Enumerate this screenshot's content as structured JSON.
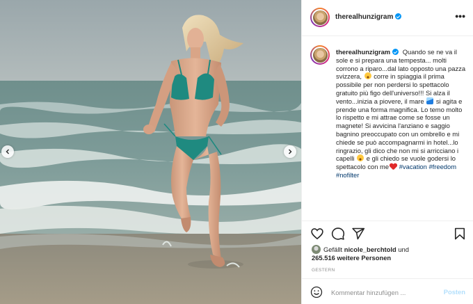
{
  "post": {
    "username": "therealhunzigram",
    "verified": true
  },
  "header": {
    "more_icon": "more-horizontal-icon"
  },
  "caption": {
    "username": "therealhunzigram",
    "part1": "Quando se ne va il sole e si prepara una tempesta... molti corrono a riparo...dal lato opposto una pazza svizzera,",
    "part2": "corre in spiaggia il prima possibile per non perdersi lo spettacolo gratuito più figo dell'universo!!! Si alza il vento...inizia a piovere, il mare",
    "part3": "si agita e prende una forma magnifica. Lo temo molto lo rispetto e mi attrae come se fosse un magnete! Si avvicina l'anziano e saggio bagnino preoccupato con un ombrello e mi chiede se può accompagnarmi in hotel...lo ringrazio, gli dico che non mi si arricciano i capelli",
    "part4": "e gli chiedo se vuole godersi lo spettacolo con me",
    "hashtags": "#vacation #freedom #nofilter"
  },
  "likes": {
    "prefix": "Gefällt",
    "liker": "nicole_berchtold",
    "connector": "und",
    "count": "265.516 weitere Personen"
  },
  "date": "GESTERN",
  "composer": {
    "placeholder": "Kommentar hinzufügen ...",
    "post_label": "Posten"
  },
  "colors": {
    "verified": "#0095f6",
    "link": "#00376b",
    "post_button_disabled": "#b2dffc",
    "muted": "#8e8e8e",
    "border": "#efefef"
  }
}
